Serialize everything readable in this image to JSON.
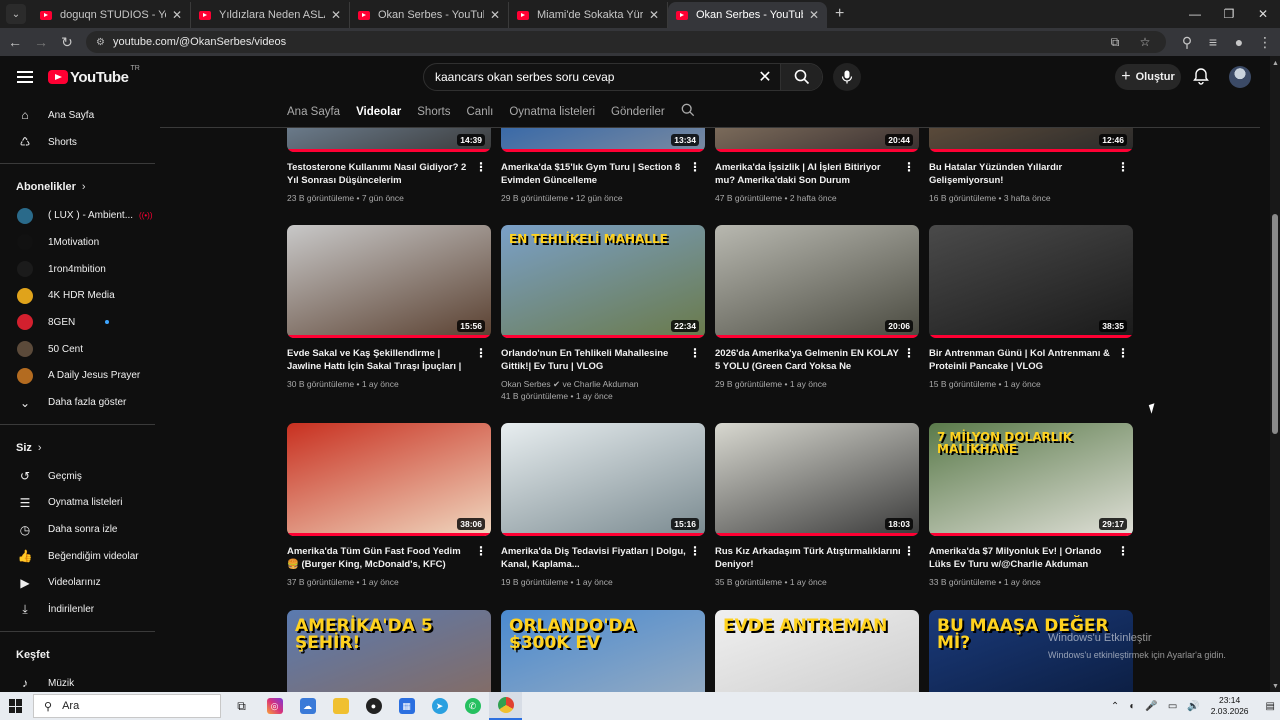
{
  "browser": {
    "tabs": [
      {
        "title": "doguqn STUDIOS - YouTube",
        "active": false
      },
      {
        "title": "Yıldızlara Neden ASLA Gidemeyiz",
        "active": false
      },
      {
        "title": "Okan Serbes - YouTube",
        "active": false
      },
      {
        "title": "Miami'de Sokakta Yürüdüm! | K",
        "active": false
      },
      {
        "title": "Okan Serbes - YouTube",
        "active": true
      }
    ],
    "close_glyph": "✕",
    "new_tab_glyph": "+",
    "url": "youtube.com/@OkanSerbes/videos"
  },
  "youtube": {
    "logo_text": "YouTube",
    "logo_region": "TR",
    "search_query": "kaancars okan serbes soru cevap",
    "create_label": "Oluştur"
  },
  "sidebar": {
    "main": [
      {
        "label": "Ana Sayfa",
        "icon": "home-icon",
        "glyph": "⌂"
      },
      {
        "label": "Shorts",
        "icon": "shorts-icon",
        "glyph": "♺"
      }
    ],
    "subscriptions_title": "Abonelikler",
    "subscriptions": [
      {
        "label": "( LUX ) - Ambient...",
        "color": "#2a6a8a",
        "live": "((•))"
      },
      {
        "label": "1Motivation",
        "color": "#111111"
      },
      {
        "label": "1ron4mbition",
        "color": "#1b1b1b"
      },
      {
        "label": "4K HDR Media",
        "color": "#e0a31b"
      },
      {
        "label": "8GEN",
        "color": "#d3202e",
        "new": true
      },
      {
        "label": "50 Cent",
        "color": "#5b4a3a"
      },
      {
        "label": "A Daily Jesus Prayer",
        "color": "#b36b20"
      }
    ],
    "show_more": "Daha fazla göster",
    "you_title": "Siz",
    "you": [
      {
        "label": "Geçmiş",
        "icon": "history-icon",
        "glyph": "↺"
      },
      {
        "label": "Oynatma listeleri",
        "icon": "playlists-icon",
        "glyph": "☰"
      },
      {
        "label": "Daha sonra izle",
        "icon": "watch-later-icon",
        "glyph": "◷"
      },
      {
        "label": "Beğendiğim videolar",
        "icon": "like-icon",
        "glyph": "👍"
      },
      {
        "label": "Videolarınız",
        "icon": "your-videos-icon",
        "glyph": "▶"
      },
      {
        "label": "İndirilenler",
        "icon": "download-icon",
        "glyph": "⤓"
      }
    ],
    "explore_title": "Keşfet",
    "explore": [
      {
        "label": "Müzik",
        "icon": "music-icon",
        "glyph": "♪"
      },
      {
        "label": "Canlı",
        "icon": "live-icon",
        "glyph": "◉"
      }
    ]
  },
  "channel_tabs": [
    {
      "label": "Ana Sayfa",
      "active": false
    },
    {
      "label": "Videolar",
      "active": true
    },
    {
      "label": "Shorts",
      "active": false
    },
    {
      "label": "Canlı",
      "active": false
    },
    {
      "label": "Oynatma listeleri",
      "active": false
    },
    {
      "label": "Gönderiler",
      "active": false
    }
  ],
  "videos": [
    {
      "title": "Testosterone Kullanımı Nasıl Gidiyor? 2 Yıl Sonrası Düşüncelerim",
      "duration": "14:39",
      "views": "23 B görüntüleme",
      "age": "7 gün önce",
      "progress": 1.0,
      "colors": [
        "#6a7a8a",
        "#3a3a3a"
      ]
    },
    {
      "title": "Amerika'da $15'lık Gym Turu | Section 8 Evimden Güncelleme",
      "duration": "13:34",
      "views": "29 B görüntüleme",
      "age": "12 gün önce",
      "progress": 1.0,
      "colors": [
        "#3a6aa8",
        "#7a8aa0"
      ]
    },
    {
      "title": "Amerika'da İşsizlik | AI İşleri Bitiriyor mu? Amerika'daki Son Durum",
      "duration": "20:44",
      "views": "47 B görüntüleme",
      "age": "2 hafta önce",
      "progress": 1.0,
      "colors": [
        "#7a6a5a",
        "#3a3030"
      ]
    },
    {
      "title": "Bu Hatalar Yüzünden Yıllardır Gelişemiyorsun!",
      "duration": "12:46",
      "views": "16 B görüntüleme",
      "age": "3 hafta önce",
      "progress": 1.0,
      "colors": [
        "#5a4a3a",
        "#2a2a2a"
      ]
    },
    {
      "title": "Evde Sakal ve Kaş Şekillendirme | Jawline Hattı İçin Sakal Tıraşı İpuçları | Erkek Bakım",
      "duration": "15:56",
      "views": "30 B görüntüleme",
      "age": "1 ay önce",
      "progress": 1.0,
      "colors": [
        "#c8c8c8",
        "#5a4030"
      ]
    },
    {
      "title": "Orlando'nun En Tehlikeli Mahallesine Gittik!| Ev Turu | VLOG @CharlieAkduman",
      "duration": "22:34",
      "channels": "Okan Serbes ✔ ve Charlie Akduman",
      "views": "41 B görüntüleme",
      "age": "1 ay önce",
      "progress": 1.0,
      "overlay": "EN TEHLİKELİ MAHALLE",
      "colors": [
        "#7aa0c8",
        "#6a7a4a"
      ]
    },
    {
      "title": "2026'da Amerika'ya Gelmenin EN KOLAY 5 YOLU (Green Card Yoksa Ne Yapabilirsin?)",
      "duration": "20:06",
      "views": "29 B görüntüleme",
      "age": "1 ay önce",
      "progress": 1.0,
      "colors": [
        "#b8b8b0",
        "#4a4a40"
      ]
    },
    {
      "title": "Bir Antrenman Günü | Kol Antrenmanı & Proteinli Pancake | VLOG",
      "duration": "38:35",
      "views": "15 B görüntüleme",
      "age": "1 ay önce",
      "progress": 1.0,
      "colors": [
        "#4a4a4a",
        "#1a1a1a"
      ]
    },
    {
      "title": "Amerika'da Tüm Gün Fast Food Yedim 🍔 (Burger King, McDonald's, KFC)",
      "duration": "38:06",
      "views": "37 B görüntüleme",
      "age": "1 ay önce",
      "progress": 1.0,
      "colors": [
        "#c83020",
        "#f0d8c0"
      ]
    },
    {
      "title": "Amerika'da Diş Tedavisi Fiyatları | Dolgu, Kanal, Kaplama...",
      "duration": "15:16",
      "views": "19 B görüntüleme",
      "age": "1 ay önce",
      "progress": 1.0,
      "colors": [
        "#e8eef0",
        "#7a8a90"
      ]
    },
    {
      "title": "Rus Kız Arkadaşım Türk Atıştırmalıklarını Deniyor!",
      "duration": "18:03",
      "views": "35 B görüntüleme",
      "age": "1 ay önce",
      "progress": 1.0,
      "colors": [
        "#d8d8d0",
        "#3a3a3a"
      ]
    },
    {
      "title": "Amerika'da $7 Milyonluk Ev! | Orlando Lüks Ev Turu w/@Charlie Akduman",
      "duration": "29:17",
      "views": "33 B görüntüleme",
      "age": "1 ay önce",
      "progress": 1.0,
      "overlay": "7 MİLYON DOLARLIK MALİKHANE",
      "colors": [
        "#5a7a4a",
        "#e0e0d8"
      ]
    },
    {
      "title": "",
      "duration": "",
      "views": "",
      "age": "",
      "progress": 0,
      "overlay": "AMERİKA'DA 5 ŞEHİR!",
      "colors": [
        "#5a7ab0",
        "#8a6a5a"
      ]
    },
    {
      "title": "",
      "duration": "",
      "views": "",
      "age": "",
      "progress": 0,
      "overlay": "ORLANDO'DA $300K EV",
      "colors": [
        "#4a8ad0",
        "#a0b0c0"
      ]
    },
    {
      "title": "",
      "duration": "",
      "views": "",
      "age": "",
      "progress": 0,
      "overlay": "EVDE ANTREMAN",
      "colors": [
        "#f0f0f0",
        "#c8c8c8"
      ]
    },
    {
      "title": "",
      "duration": "",
      "views": "",
      "age": "",
      "progress": 0,
      "overlay": "BU MAAŞA DEĞER Mİ?",
      "colors": [
        "#1a3a7a",
        "#0a1a3a"
      ]
    }
  ],
  "watermark": {
    "line1": "Windows'u Etkinleştir",
    "line2": "Windows'u etkinleştirmek için Ayarlar'a gidin."
  },
  "taskbar": {
    "search_placeholder": "Ara",
    "time": "23:14",
    "date": "2.03.2026"
  }
}
